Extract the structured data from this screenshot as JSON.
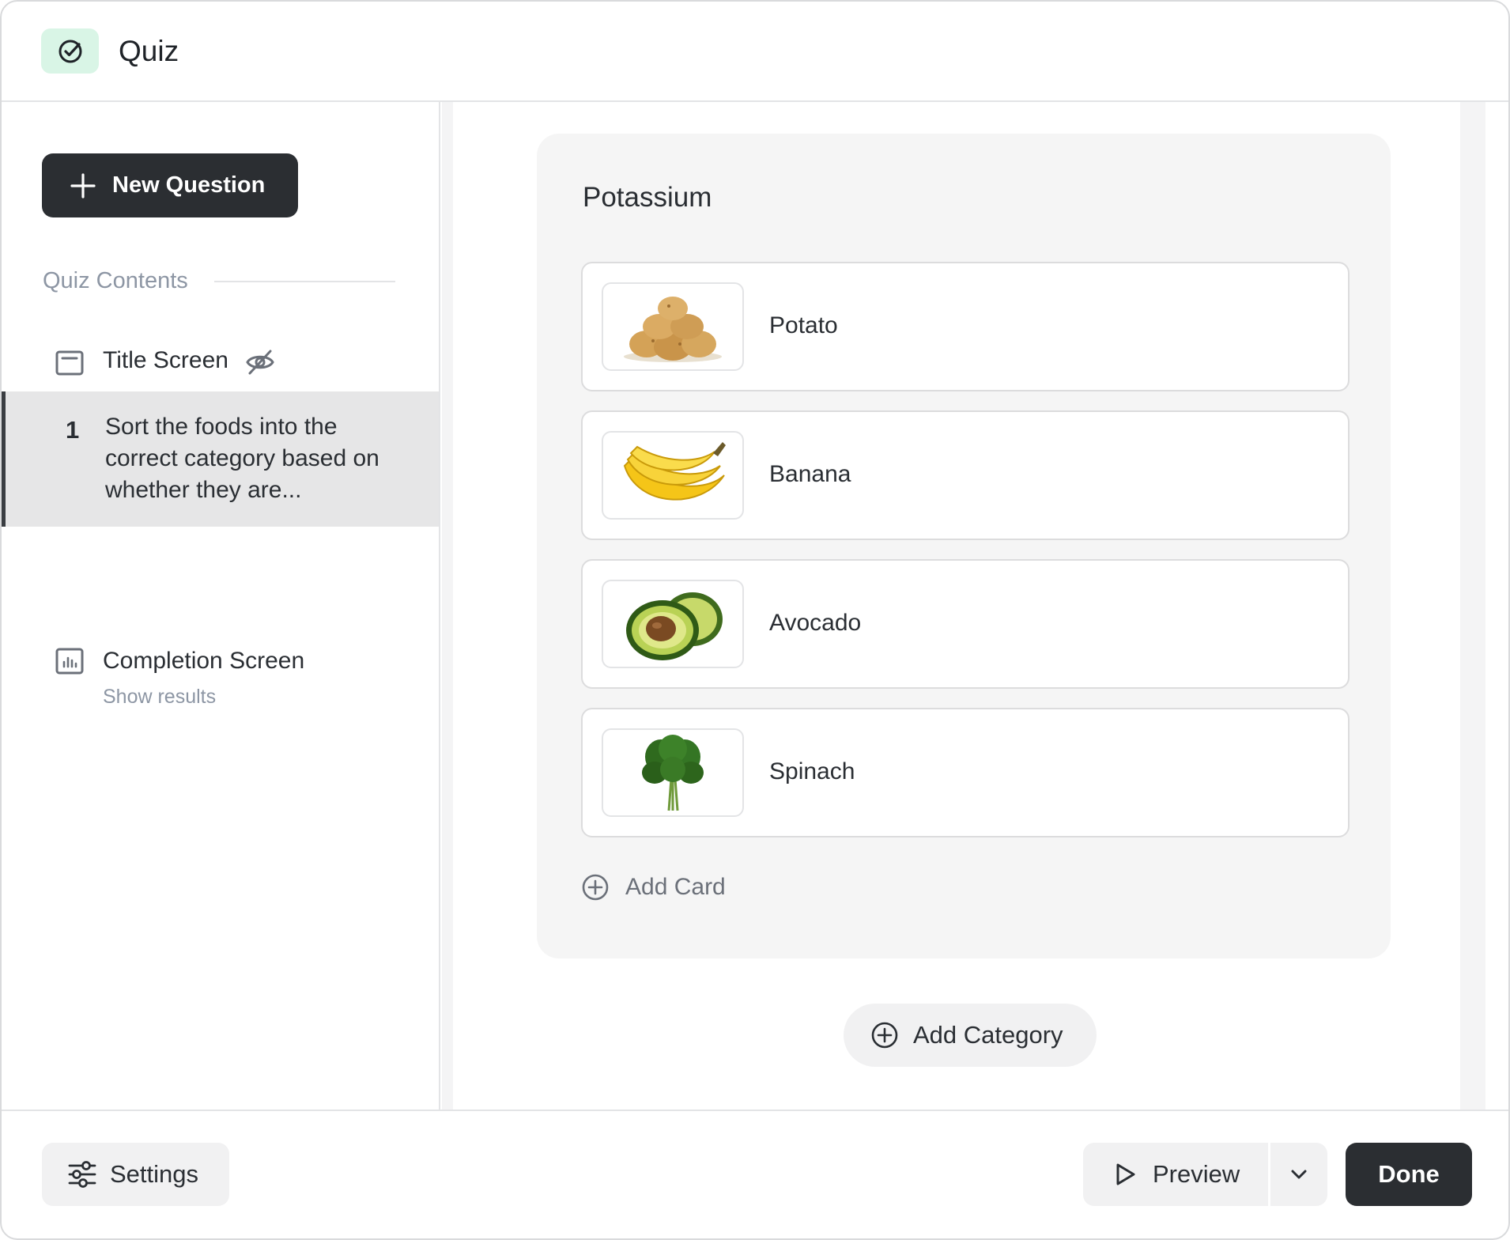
{
  "app": {
    "title": "Quiz",
    "icon": "check-circle-icon",
    "accent": "#d9f5e6"
  },
  "sidebar": {
    "new_question_label": "New Question",
    "contents_heading": "Quiz Contents",
    "title_screen_label": "Title Screen",
    "question": {
      "number": "1",
      "text": "Sort the foods into the correct category based on whether they are..."
    },
    "completion": {
      "label": "Completion Screen",
      "sub": "Show results"
    }
  },
  "category": {
    "title": "Potassium",
    "cards": [
      {
        "label": "Potato",
        "image": "potato-image"
      },
      {
        "label": "Banana",
        "image": "banana-image"
      },
      {
        "label": "Avocado",
        "image": "avocado-image"
      },
      {
        "label": "Spinach",
        "image": "spinach-image"
      }
    ],
    "add_card_label": "Add Card"
  },
  "add_category_label": "Add Category",
  "footer": {
    "settings_label": "Settings",
    "preview_label": "Preview",
    "done_label": "Done"
  }
}
